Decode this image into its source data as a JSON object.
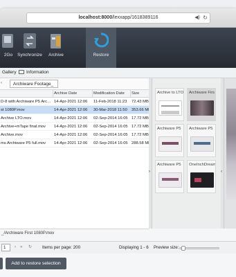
{
  "browser": {
    "url_host": "localhost:8000",
    "url_path": "/lexxapp/1618389116"
  },
  "toolbar": {
    "items": [
      {
        "label": "2Go"
      },
      {
        "label": "Synchronize"
      },
      {
        "label": "Archive"
      },
      {
        "label": "Restore"
      }
    ],
    "active": "Restore"
  },
  "tabs": {
    "gallery": "Gallery",
    "information": "Information"
  },
  "path": {
    "crumb": "Archiware Footage_"
  },
  "table": {
    "headers": [
      "",
      "Archive Date",
      "Modification Date",
      "Size"
    ],
    "rows": [
      {
        "name": "D-8 with Archiware P5 Arc…",
        "archive_date": "14-Apr-2021 12:06",
        "mod_date": "11-Feb-2018 11:23",
        "size": "72.43 MB"
      },
      {
        "name": "st 1080P.mov",
        "archive_date": "14-Apr-2021 12:06",
        "mod_date": "30-Mar-2018 11:50",
        "size": "353.66 MB"
      },
      {
        "name": "Archive LTO.mov",
        "archive_date": "14-Apr-2021 12:06",
        "mod_date": "02-Sep-2014 16:05",
        "size": "17.72 MB"
      },
      {
        "name": "Archive+mTape final.mov",
        "archive_date": "14-Apr-2021 12:06",
        "mod_date": "02-Sep-2014 16:05",
        "size": "17.72 MB"
      },
      {
        "name": "Archive.mov",
        "archive_date": "14-Apr-2021 12:06",
        "mod_date": "02-Sep-2014 16:05",
        "size": "17.72 MB"
      },
      {
        "name": "ms Archiware P5 full.mov",
        "archive_date": "14-Apr-2021 12:06",
        "mod_date": "02-Sep-2014 16:05",
        "size": "288.58 MB"
      }
    ],
    "selected_index": 1
  },
  "gallery": {
    "thumbs": [
      {
        "label": "Archive to LTO",
        "color": "#ffffff"
      },
      {
        "label": "Archiware Firs",
        "color": "#6b5a63"
      },
      {
        "label": "Archiware P5",
        "color": "#e9e9ee"
      },
      {
        "label": "Archiware P5",
        "color": "#dfe1e6"
      },
      {
        "label": "Archiware P5",
        "color": "#e7e5ea"
      },
      {
        "label": "OneInchDream",
        "color": "#2a2a30"
      }
    ]
  },
  "path_info": "_/Archiware First 1080P.mov",
  "pager": {
    "page": "1",
    "items_per_page_label": "Items per page: 200",
    "displaying": "Displaying 1 - 6",
    "preview_size_label": "Preview size:"
  },
  "footer": {
    "restore_button": "Add to restore selection"
  },
  "colors": {
    "toolbar_dark": "#2b313a",
    "selection": "#c8dcf4",
    "button": "#505864"
  }
}
